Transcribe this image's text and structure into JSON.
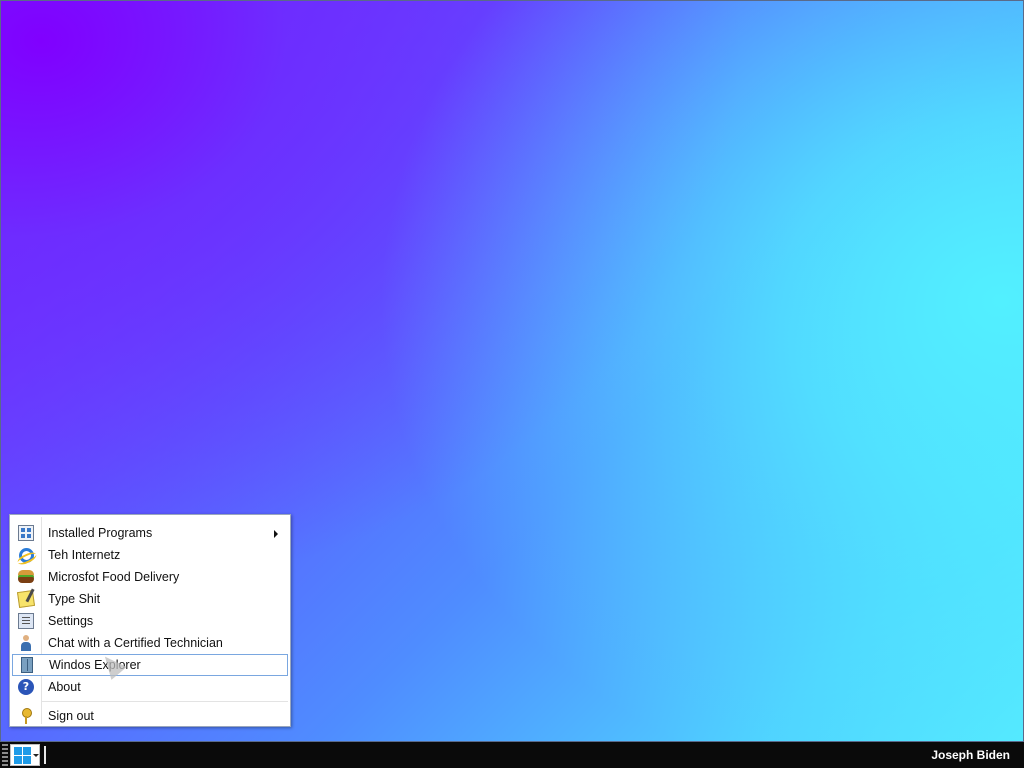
{
  "start_menu": {
    "items": [
      {
        "label": "Installed Programs",
        "icon": "installed-programs-icon",
        "has_submenu": true
      },
      {
        "label": "Teh Internetz",
        "icon": "internet-explorer-icon"
      },
      {
        "label": "Microsfot Food Delivery",
        "icon": "hamburger-icon"
      },
      {
        "label": "Type Shit",
        "icon": "notepad-icon"
      },
      {
        "label": "Settings",
        "icon": "settings-icon"
      },
      {
        "label": "Chat with a Certified Technician",
        "icon": "technician-icon"
      },
      {
        "label": "Windos Explorer",
        "icon": "file-explorer-icon",
        "selected": true
      },
      {
        "label": "About",
        "icon": "help-icon",
        "glyph": "?"
      }
    ],
    "sign_out": {
      "label": "Sign out",
      "icon": "key-icon"
    }
  },
  "taskbar": {
    "start_icon": "windows-logo-icon",
    "user_name": "Joseph Biden"
  }
}
